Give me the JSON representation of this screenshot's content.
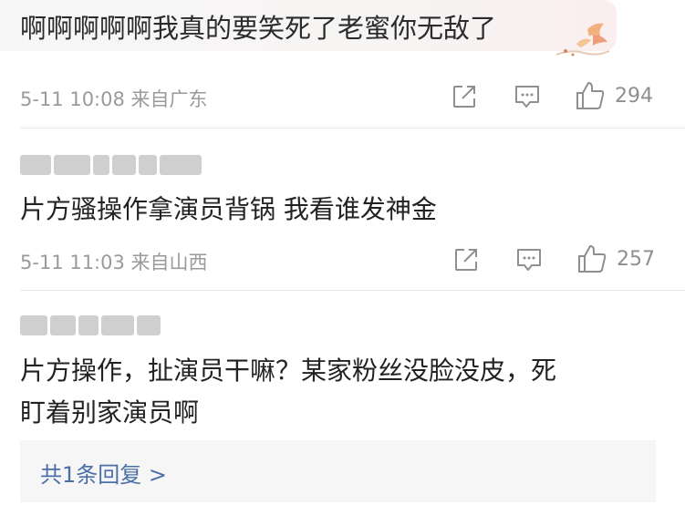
{
  "comments": [
    {
      "text": "啊啊啊啊啊我真的要笑死了老蜜你无敌了",
      "meta": "5-11 10:08 来自广东",
      "likes": "294"
    },
    {
      "text": "片方骚操作拿演员背锅 我看谁发神金",
      "meta": "5-11 11:03 来自山西",
      "likes": "257"
    },
    {
      "text_line1": "片方操作，扯演员干嘛？某家粉丝没脸没皮，死",
      "text_line2": "盯着别家演员啊",
      "reply_link": "共1条回复 >"
    }
  ],
  "icons": {
    "share": "share-icon",
    "comment": "comment-icon",
    "like": "thumbs-up-icon",
    "decoration": "phoenix-decoration-icon"
  },
  "colors": {
    "meta_gray": "#9a9a9a",
    "link_blue": "#4a6fa8",
    "reply_bg": "#f6f6f6"
  }
}
